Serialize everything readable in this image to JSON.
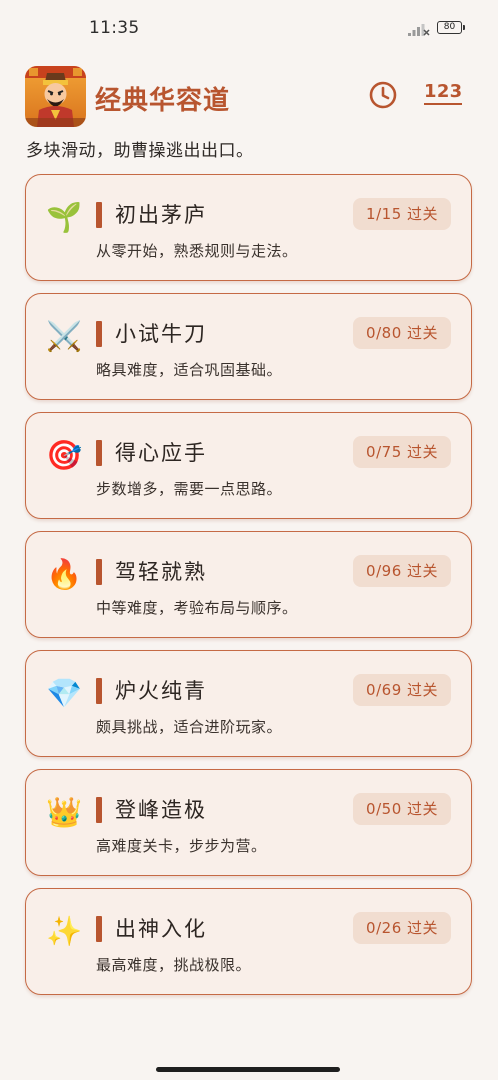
{
  "status": {
    "time": "11:35",
    "battery": "80"
  },
  "header": {
    "title": "经典华容道",
    "records_label": "123",
    "subtitle": "多块滑动，助曹操逃出出口。"
  },
  "levels": [
    {
      "icon": "🌱",
      "icon_name": "seedling-icon",
      "name": "初出茅庐",
      "desc": "从零开始，熟悉规则与走法。",
      "progress": "1/15 过关"
    },
    {
      "icon": "⚔️",
      "icon_name": "crossed-swords-icon",
      "name": "小试牛刀",
      "desc": "略具难度，适合巩固基础。",
      "progress": "0/80 过关"
    },
    {
      "icon": "🎯",
      "icon_name": "target-icon",
      "name": "得心应手",
      "desc": "步数增多，需要一点思路。",
      "progress": "0/75 过关"
    },
    {
      "icon": "🔥",
      "icon_name": "fire-icon",
      "name": "驾轻就熟",
      "desc": "中等难度，考验布局与顺序。",
      "progress": "0/96 过关"
    },
    {
      "icon": "💎",
      "icon_name": "gem-icon",
      "name": "炉火纯青",
      "desc": "颇具挑战，适合进阶玩家。",
      "progress": "0/69 过关"
    },
    {
      "icon": "👑",
      "icon_name": "crown-icon",
      "name": "登峰造极",
      "desc": "高难度关卡，步步为营。",
      "progress": "0/50 过关"
    },
    {
      "icon": "✨",
      "icon_name": "sparkles-icon",
      "name": "出神入化",
      "desc": "最高难度，挑战极限。",
      "progress": "0/26 过关"
    }
  ],
  "colors": {
    "accent": "#b8552f",
    "card_bg": "#f9efe9",
    "card_border": "#c56a45",
    "badge_bg": "#f1ddd0",
    "page_bg": "#f8f4f1"
  }
}
